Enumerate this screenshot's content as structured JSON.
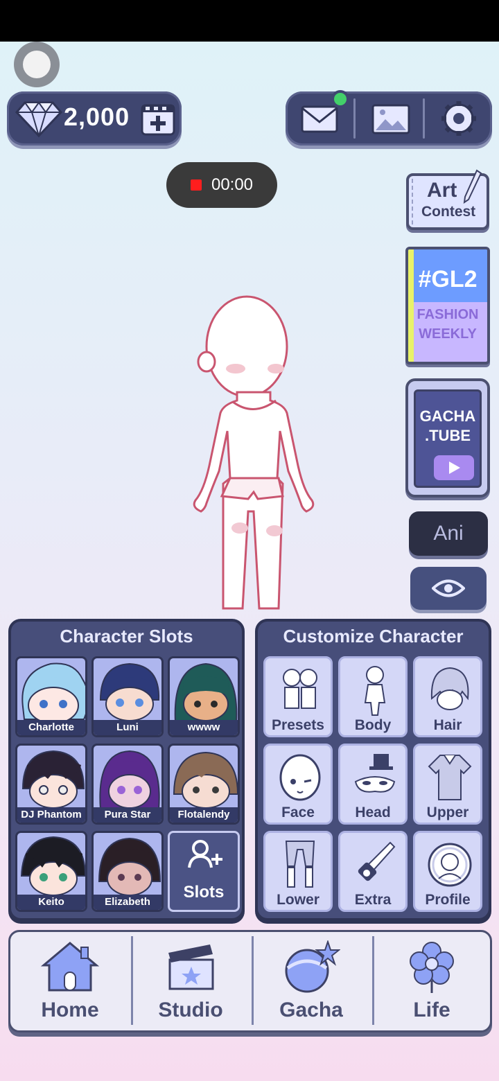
{
  "header": {
    "gems": "2,000",
    "gem_icon": "diamond-icon",
    "add_icon": "film-plus-icon",
    "mail_icon": "mail-icon",
    "gallery_icon": "image-icon",
    "settings_icon": "gear-icon"
  },
  "recording": {
    "time": "00:00"
  },
  "side": {
    "art_contest": {
      "line1": "Art",
      "line2": "Contest"
    },
    "gl2": {
      "tag": "#GL2",
      "line1": "FASHION",
      "line2": "WEEKLY"
    },
    "gacha_tube": {
      "line1": "GACHA",
      "line2": ".TUBE"
    },
    "ani": "Ani",
    "eye_icon": "eye-icon"
  },
  "slots_panel": {
    "title": "Character Slots",
    "slots": [
      {
        "name": "Charlotte"
      },
      {
        "name": "Luni"
      },
      {
        "name": "wwww"
      },
      {
        "name": "DJ Phantom"
      },
      {
        "name": "Pura Star"
      },
      {
        "name": "Flotalendy"
      },
      {
        "name": "Keito"
      },
      {
        "name": "Elizabeth"
      }
    ],
    "add_label": "Slots"
  },
  "customize_panel": {
    "title": "Customize Character",
    "items": [
      {
        "label": "Presets"
      },
      {
        "label": "Body"
      },
      {
        "label": "Hair"
      },
      {
        "label": "Face"
      },
      {
        "label": "Head"
      },
      {
        "label": "Upper"
      },
      {
        "label": "Lower"
      },
      {
        "label": "Extra"
      },
      {
        "label": "Profile"
      }
    ]
  },
  "nav": [
    {
      "label": "Home",
      "icon": "house-icon"
    },
    {
      "label": "Studio",
      "icon": "clapperboard-icon"
    },
    {
      "label": "Gacha",
      "icon": "gacha-orb-icon"
    },
    {
      "label": "Life",
      "icon": "flower-icon"
    }
  ],
  "colors": {
    "panel": "#474e7a",
    "accent": "#6d9cff",
    "notification": "#43d06a"
  }
}
